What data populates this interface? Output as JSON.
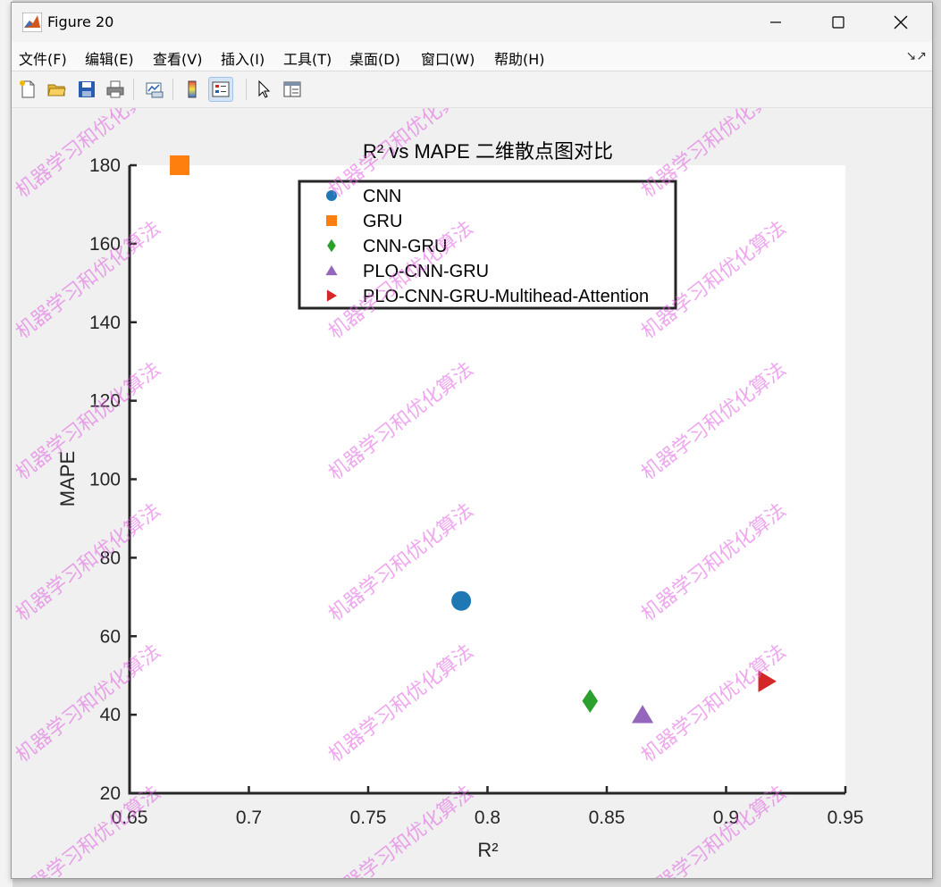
{
  "window": {
    "title": "Figure 20"
  },
  "menu": {
    "items": [
      "文件(F)",
      "编辑(E)",
      "查看(V)",
      "插入(I)",
      "工具(T)",
      "桌面(D)",
      "窗口(W)",
      "帮助(H)"
    ]
  },
  "toolbar": {
    "icons": [
      "new-figure-icon",
      "open-file-icon",
      "save-icon",
      "print-icon",
      "link-plot-icon",
      "colorbar-icon",
      "legend-icon",
      "pointer-icon",
      "property-editor-icon"
    ]
  },
  "watermark": "机器学习和优化算法",
  "chart_data": {
    "type": "scatter",
    "title": "R² vs MAPE 二维散点图对比",
    "xlabel": "R²",
    "ylabel": "MAPE",
    "xlim": [
      0.65,
      0.95
    ],
    "ylim": [
      20,
      180
    ],
    "xticks": [
      "0.65",
      "0.7",
      "0.75",
      "0.8",
      "0.85",
      "0.9",
      "0.95"
    ],
    "yticks": [
      "20",
      "40",
      "60",
      "80",
      "100",
      "120",
      "140",
      "160",
      "180"
    ],
    "grid": false,
    "legend_position": "top",
    "series": [
      {
        "name": "CNN",
        "x": 0.789,
        "y": 69,
        "marker": "circle",
        "color": "#1f77b4"
      },
      {
        "name": "GRU",
        "x": 0.671,
        "y": 180,
        "marker": "square",
        "color": "#ff7f0e"
      },
      {
        "name": "CNN-GRU",
        "x": 0.843,
        "y": 43.5,
        "marker": "diamond",
        "color": "#2ca02c"
      },
      {
        "name": "PLO-CNN-GRU",
        "x": 0.865,
        "y": 40,
        "marker": "triangle-up",
        "color": "#9467bd"
      },
      {
        "name": "PLO-CNN-GRU-Multihead-Attention",
        "x": 0.917,
        "y": 48.5,
        "marker": "triangle-right",
        "color": "#d62728"
      }
    ]
  }
}
